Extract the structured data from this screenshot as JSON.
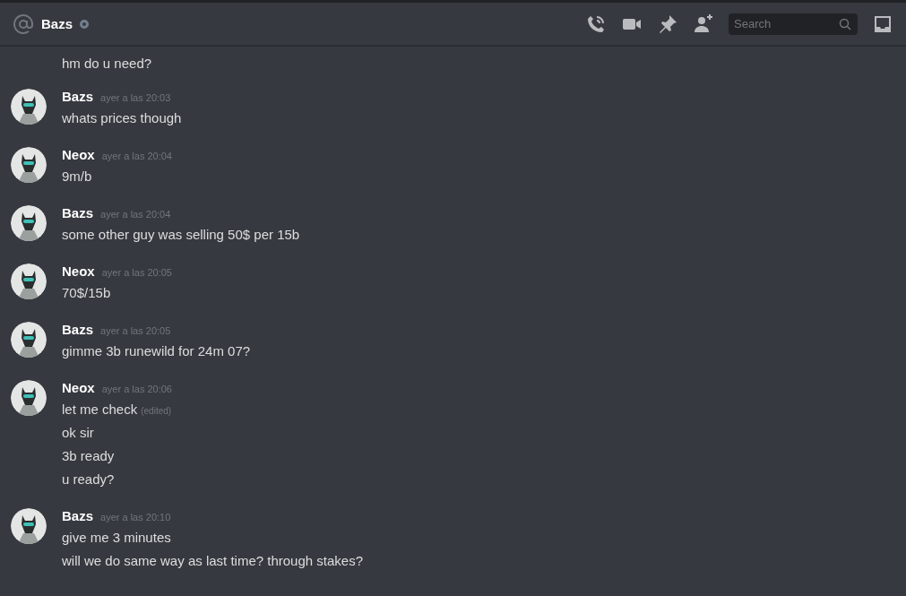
{
  "header": {
    "channel_name": "Bazs",
    "search": {
      "placeholder": "Search"
    }
  },
  "messages": [
    {
      "lines": [
        {
          "text": "hm do u need?"
        }
      ]
    },
    {
      "author": "Bazs",
      "avatar": {
        "kind": "picture"
      },
      "time": "ayer a las 20:03",
      "lines": [
        {
          "text": "whats prices though"
        }
      ]
    },
    {
      "author": "Neox",
      "avatar": {
        "kind": "picture"
      },
      "time": "ayer a las 20:04",
      "lines": [
        {
          "text": "9m/b"
        }
      ]
    },
    {
      "author": "Bazs",
      "avatar": {
        "kind": "picture"
      },
      "time": "ayer a las 20:04",
      "lines": [
        {
          "text": "some other guy was selling 50$ per 15b"
        }
      ]
    },
    {
      "author": "Neox",
      "avatar": {
        "kind": "picture"
      },
      "time": "ayer a las 20:05",
      "lines": [
        {
          "text": "70$/15b"
        }
      ]
    },
    {
      "author": "Bazs",
      "avatar": {
        "kind": "picture"
      },
      "time": "ayer a las 20:05",
      "lines": [
        {
          "text": "gimme 3b runewild for 24m 07?"
        }
      ]
    },
    {
      "author": "Neox",
      "avatar": {
        "kind": "picture"
      },
      "time": "ayer a las 20:06",
      "lines": [
        {
          "text": "let me check",
          "edited": "(edited)"
        },
        {
          "text": "ok sir"
        },
        {
          "text": "3b ready"
        },
        {
          "text": "u ready?"
        }
      ]
    },
    {
      "author": "Bazs",
      "avatar": {
        "kind": "picture"
      },
      "time": "ayer a las 20:10",
      "lines": [
        {
          "text": "give me 3 minutes"
        },
        {
          "text": "will we do same way as last time? through stakes?"
        }
      ]
    }
  ]
}
